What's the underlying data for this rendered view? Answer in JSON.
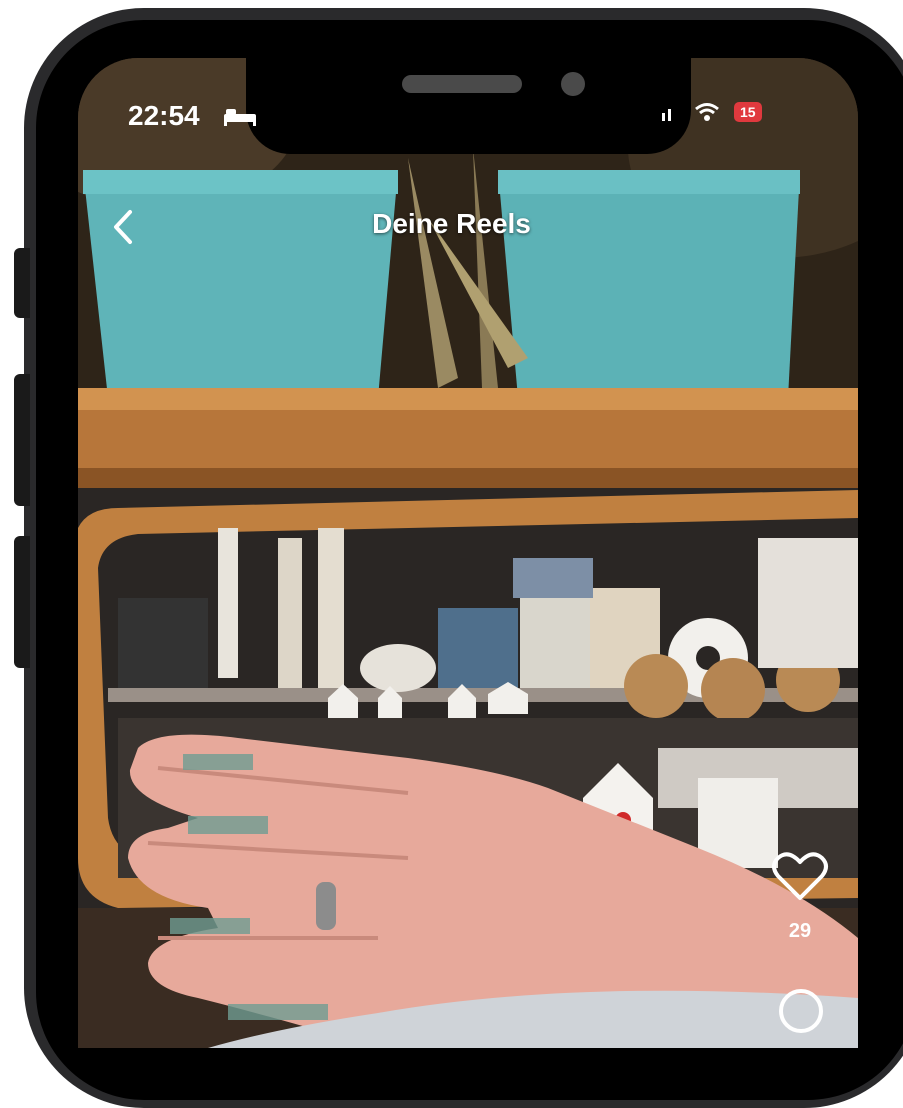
{
  "status_bar": {
    "time": "22:54",
    "battery": "15",
    "icons": [
      "bed-icon",
      "signal-icon",
      "wifi-icon",
      "battery-icon"
    ]
  },
  "header": {
    "title": "Deine Reels",
    "back_icon": "chevron-left-icon"
  },
  "actions": {
    "like_icon": "heart-icon",
    "like_count": "29",
    "comment_icon": "comment-icon"
  },
  "colors": {
    "text": "#ffffff",
    "battery_low": "#e0393e",
    "frame": "#2a2a2c"
  }
}
